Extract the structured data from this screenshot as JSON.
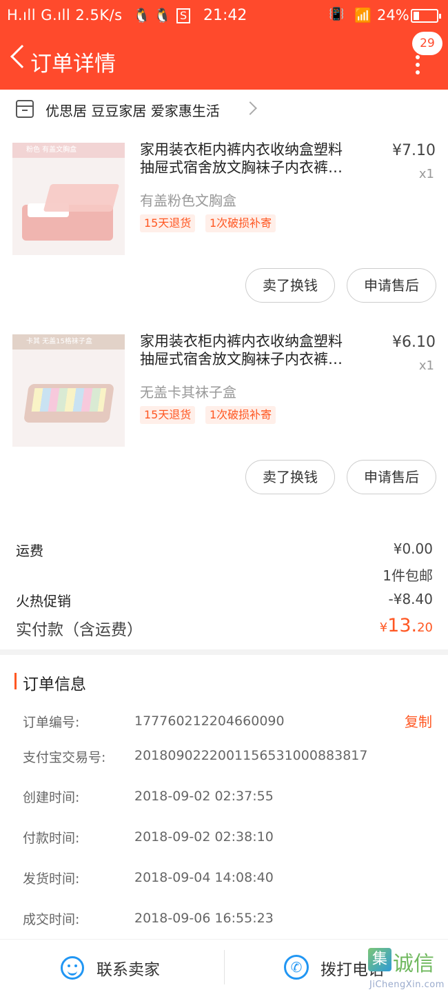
{
  "status_bar": {
    "network": "H.ıll G.ıll",
    "speed": "2.5K/s",
    "qq1": "🐧",
    "qq2": "🐧",
    "sim": "S",
    "time": "21:42",
    "vibrate": "📳",
    "wifi": "📶",
    "battery": "24%"
  },
  "nav": {
    "title": "订单详情",
    "badge": "29",
    "back_icon": "chevron-left-icon",
    "more_icon": "more-vertical-icon"
  },
  "shop": {
    "name": "优思居 豆豆家居 爱家惠生活",
    "icon": "store-icon"
  },
  "items": [
    {
      "thumb_tag": "粉色 有盖文胸盒",
      "title_line1": "家用装衣柜内裤内衣收纳盒塑料",
      "title_line2": "抽屉式宿舍放文胸袜子内衣裤…",
      "price": "¥7.10",
      "qty": "x1",
      "variant": "有盖粉色文胸盒",
      "tags": [
        "15天退货",
        "1次破损补寄"
      ],
      "buttons": [
        "卖了换钱",
        "申请售后"
      ]
    },
    {
      "thumb_tag": "卡其 无盖15格袜子盒",
      "title_line1": "家用装衣柜内裤内衣收纳盒塑料",
      "title_line2": "抽屉式宿舍放文胸袜子内衣裤…",
      "price": "¥6.10",
      "qty": "x1",
      "variant": "无盖卡其袜子盒",
      "tags": [
        "15天退货",
        "1次破损补寄"
      ],
      "buttons": [
        "卖了换钱",
        "申请售后"
      ]
    }
  ],
  "summary": {
    "shipping_label": "运费",
    "shipping_value": "¥0.00",
    "shipping_note": "1件包邮",
    "promo_label": "火热促销",
    "promo_value": "-¥8.40",
    "paid_label": "实付款（含运费）",
    "paid_symbol": "¥",
    "paid_int": "13.",
    "paid_dec": "20"
  },
  "order_info": {
    "title": "订单信息",
    "copy_label": "复制",
    "rows": [
      {
        "label": "订单编号:",
        "value": "177760212204660090"
      },
      {
        "label": "支付宝交易号:",
        "value": "2018090222001156531000883817"
      },
      {
        "label": "创建时间:",
        "value": "2018-09-02 02:37:55"
      },
      {
        "label": "付款时间:",
        "value": "2018-09-02 02:38:10"
      },
      {
        "label": "发货时间:",
        "value": "2018-09-04 14:08:40"
      },
      {
        "label": "成交时间:",
        "value": "2018-09-06 16:55:23"
      }
    ]
  },
  "bottom_bar": {
    "contact_seller": "联系卖家",
    "call_phone": "拨打电话"
  },
  "watermark": {
    "logo_char": "集",
    "text": "诚信",
    "url": "JiChengXin.com"
  },
  "colors": {
    "brand": "#ff4a2c",
    "accent": "#ff5722",
    "link_blue": "#2196f3"
  }
}
